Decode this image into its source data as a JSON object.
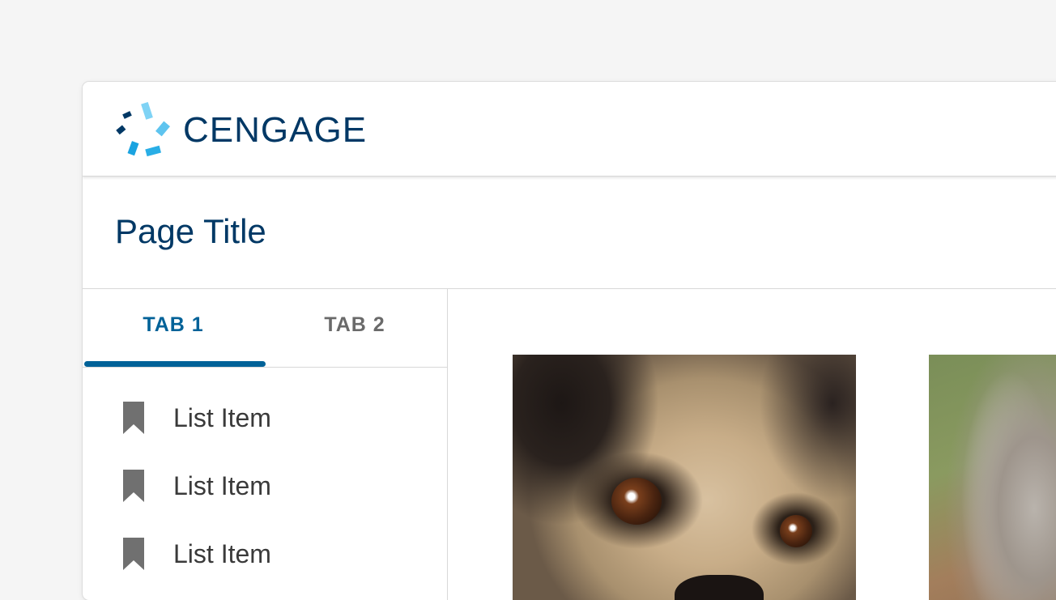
{
  "brand": {
    "name": "CENGAGE",
    "colors": {
      "primary": "#003865",
      "accent": "#006298",
      "logo_light_blue": "#5ec4ef",
      "logo_mid_blue": "#1aa3e0"
    }
  },
  "page": {
    "title": "Page Title"
  },
  "tabs": [
    {
      "label": "TAB 1",
      "active": true
    },
    {
      "label": "TAB 2",
      "active": false
    }
  ],
  "list": {
    "items": [
      {
        "label": "List Item",
        "icon": "bookmark-icon"
      },
      {
        "label": "List Item",
        "icon": "bookmark-icon"
      },
      {
        "label": "List Item",
        "icon": "bookmark-icon"
      }
    ]
  },
  "content": {
    "images": [
      {
        "subject": "pug"
      },
      {
        "subject": "dog"
      }
    ]
  }
}
